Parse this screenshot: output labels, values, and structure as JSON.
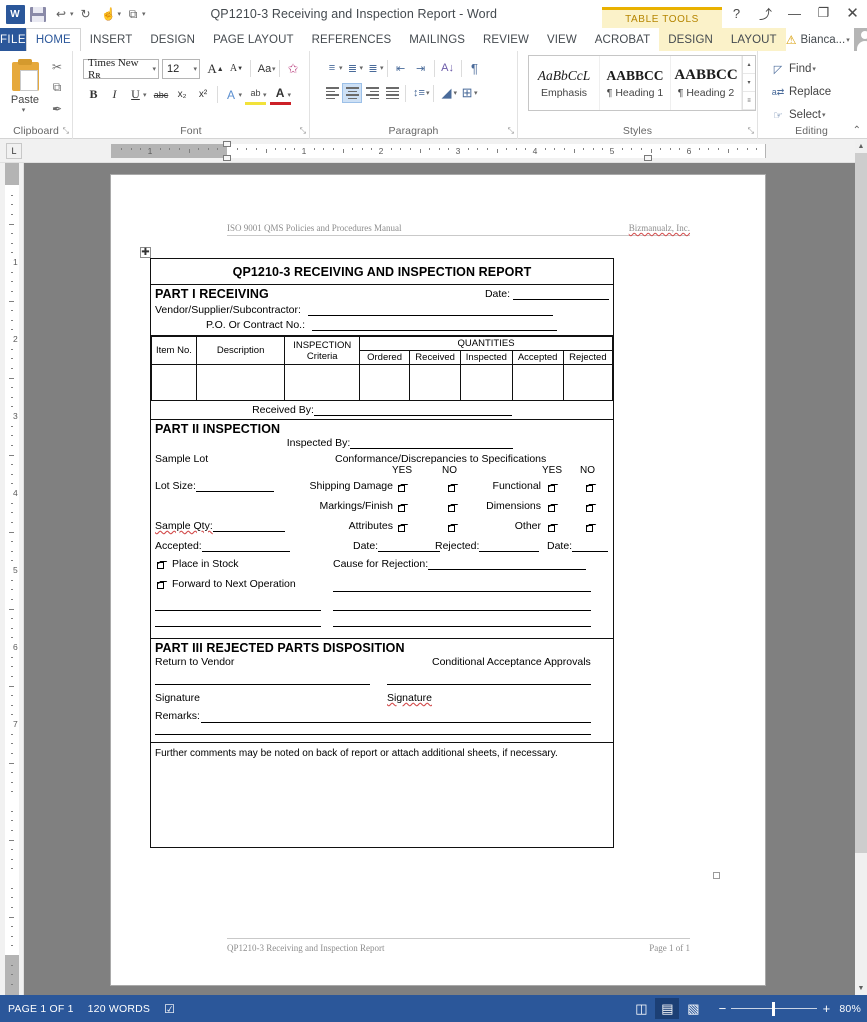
{
  "window": {
    "title": "QP1210-3 Receiving and Inspection Report - Word",
    "contextual_tools_label": "TABLE TOOLS",
    "help_label": "?",
    "ribbon_display_label": "⤴",
    "minimize_label": "—",
    "restore_label": "❐",
    "close_label": "✕",
    "qat": [
      {
        "name": "word-logo",
        "label": "W"
      },
      {
        "name": "save-icon",
        "label": ""
      },
      {
        "name": "undo-icon",
        "label": "↩"
      },
      {
        "name": "redo-icon",
        "label": "↻"
      },
      {
        "name": "touch-mode-icon",
        "label": "☝"
      },
      {
        "name": "customize-qat-icon",
        "label": "☰"
      }
    ]
  },
  "tabs": {
    "file": "FILE",
    "items": [
      "HOME",
      "INSERT",
      "DESIGN",
      "PAGE LAYOUT",
      "REFERENCES",
      "MAILINGS",
      "REVIEW",
      "VIEW",
      "ACROBAT"
    ],
    "active": "HOME",
    "contextual": [
      "DESIGN",
      "LAYOUT"
    ],
    "account_name": "Bianca...",
    "account_caret": "▾"
  },
  "ribbon": {
    "clipboard": {
      "label": "Clipboard",
      "paste": "Paste",
      "paste_caret": "▾",
      "cut": "✂",
      "copy": "⧉",
      "format_painter": "✒",
      "dialog": "⤡"
    },
    "font": {
      "label": "Font",
      "font_name": "Times New Rʀ",
      "font_size": "12",
      "grow_font": "A",
      "shrink_font": "A",
      "change_case": "Aa",
      "clear_formatting": "A",
      "bold": "B",
      "italic": "I",
      "underline": "U",
      "strikethrough": "abc",
      "subscript": "x₂",
      "superscript": "x²",
      "text_effects": "A",
      "highlight": "ab",
      "font_color": "A",
      "dialog": "⤡",
      "caret": "▾"
    },
    "paragraph": {
      "label": "Paragraph",
      "bullets": "•≡",
      "numbering": "1≡",
      "multilevel": "≣",
      "decrease_indent": "←≡",
      "increase_indent": "≡→",
      "sort": "A↓",
      "show_marks": "¶",
      "align_left": "≡",
      "align_center": "≡",
      "align_right": "≡",
      "justify": "≡",
      "line_spacing": "↕≡",
      "shading": "△",
      "borders": "⊞",
      "dialog": "⤡",
      "caret": "▾"
    },
    "styles": {
      "label": "Styles",
      "dialog": "⤡",
      "scroll_up": "▴",
      "scroll_down": "▾",
      "scroll_more": "≡",
      "items": [
        {
          "preview": "AaBbCcL",
          "name": "Emphasis",
          "style": "em"
        },
        {
          "preview": "AABBCC",
          "name": "¶ Heading 1",
          "style": "h1"
        },
        {
          "preview": "AABBCC",
          "name": "¶ Heading 2",
          "style": "h2"
        }
      ]
    },
    "editing": {
      "label": "Editing",
      "find": "Find",
      "find_caret": "▾",
      "replace": "Replace",
      "select": "Select",
      "select_caret": "▾",
      "collapse_ribbon": "⌃"
    }
  },
  "ruler": {
    "tab_stop_label": "L",
    "h_numbers": [
      "1",
      "1",
      "2",
      "3",
      "4",
      "5"
    ],
    "v_numbers": [
      "1",
      "2",
      "3",
      "4",
      "5",
      "6",
      "7"
    ]
  },
  "document": {
    "header_left": "ISO 9001 QMS Policies and Procedures Manual",
    "header_right": "Bizmanualz, Inc.",
    "footer_left": "QP1210-3 Receiving and Inspection Report",
    "footer_right": "Page 1 of 1",
    "table_move_handle": "✚",
    "form": {
      "title": "QP1210-3 RECEIVING AND INSPECTION REPORT",
      "part1": {
        "heading": "PART I RECEIVING",
        "date_label": "Date:",
        "vendor_label": "Vendor/Supplier/Subcontractor:",
        "po_label": "P.O.  Or Contract No.:",
        "quantities_header": "QUANTITIES",
        "columns": [
          "Item No.",
          "Description",
          "INSPECTION Criteria",
          "Ordered",
          "Received",
          "Inspected",
          "Accepted",
          "Rejected"
        ],
        "inspection_criteria_line1": "INSPECTION",
        "inspection_criteria_line2": "Criteria",
        "received_by_label": "Received By:"
      },
      "part2": {
        "heading": "PART II INSPECTION",
        "inspected_by_label": "Inspected By:",
        "sample_lot_label": "Sample Lot",
        "conformance_label": "Conformance/Discrepancies to Specifications",
        "yes_label": "YES",
        "no_label": "NO",
        "lot_size_label": "Lot Size:",
        "sample_qty_label": "Sample Qty:",
        "criteria_left": [
          "Shipping Damage",
          "Markings/Finish",
          "Attributes"
        ],
        "criteria_right": [
          "Functional",
          "Dimensions",
          "Other"
        ],
        "accepted_label": "Accepted:",
        "date_label": "Date:",
        "rejected_label": "Rejected:",
        "date2_label": "Date:",
        "place_in_stock": "Place in Stock",
        "forward_next_op": "Forward to Next Operation",
        "cause_label": "Cause for Rejection:"
      },
      "part3": {
        "heading": "PART III REJECTED PARTS DISPOSITION",
        "return_to_vendor": "Return to Vendor",
        "conditional_approvals": "Conditional Acceptance Approvals",
        "signature_left": "Signature",
        "signature_right": "Signature",
        "remarks_label": "Remarks:",
        "further_comments": "Further comments may be noted on back of report or attach additional sheets, if necessary."
      }
    }
  },
  "statusbar": {
    "page_info": "PAGE 1 OF 1",
    "word_count": "120 WORDS",
    "proofing_icon": "☑",
    "views": [
      {
        "name": "read-mode-icon",
        "label": "◫",
        "active": false
      },
      {
        "name": "print-layout-icon",
        "label": "▤",
        "active": true
      },
      {
        "name": "web-layout-icon",
        "label": "▧",
        "active": false
      }
    ],
    "zoom_out": "−",
    "zoom_in": "+",
    "zoom_level": "80%"
  }
}
